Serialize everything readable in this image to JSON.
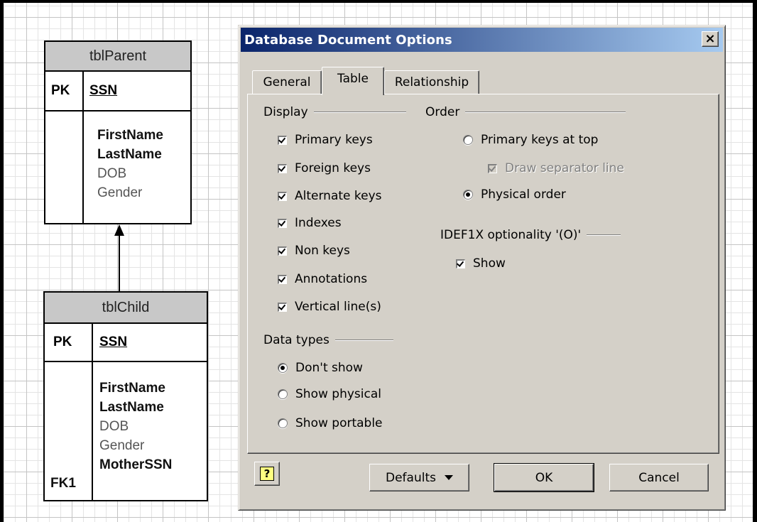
{
  "er_diagram": {
    "parent": {
      "name": "tblParent",
      "pk_label": "PK",
      "pk_field": "SSN",
      "fields": [
        {
          "name": "FirstName",
          "bold": true
        },
        {
          "name": "LastName",
          "bold": true
        },
        {
          "name": "DOB",
          "bold": false
        },
        {
          "name": "Gender",
          "bold": false
        }
      ]
    },
    "child": {
      "name": "tblChild",
      "pk_label": "PK",
      "pk_field": "SSN",
      "fk_label": "FK1",
      "fields": [
        {
          "name": "FirstName",
          "bold": true
        },
        {
          "name": "LastName",
          "bold": true
        },
        {
          "name": "DOB",
          "bold": false
        },
        {
          "name": "Gender",
          "bold": false
        },
        {
          "name": "MotherSSN",
          "bold": true
        }
      ]
    }
  },
  "dialog": {
    "title": "Database Document Options",
    "close_glyph": "×",
    "tabs": [
      {
        "label": "General",
        "active": false
      },
      {
        "label": "Table",
        "active": true
      },
      {
        "label": "Relationship",
        "active": false
      }
    ],
    "display": {
      "label": "Display",
      "options": [
        {
          "label": "Primary keys",
          "checked": true
        },
        {
          "label": "Foreign keys",
          "checked": true
        },
        {
          "label": "Alternate keys",
          "checked": true
        },
        {
          "label": "Indexes",
          "checked": true
        },
        {
          "label": "Non keys",
          "checked": true
        },
        {
          "label": "Annotations",
          "checked": true
        },
        {
          "label": "Vertical line(s)",
          "checked": true
        }
      ]
    },
    "data_types": {
      "label": "Data types",
      "options": [
        {
          "label": "Don't show",
          "selected": true
        },
        {
          "label": "Show physical",
          "selected": false
        },
        {
          "label": "Show portable",
          "selected": false
        }
      ]
    },
    "order": {
      "label": "Order",
      "primary_top": {
        "label": "Primary keys at top",
        "selected": false
      },
      "separator": {
        "label": "Draw separator line",
        "checked": true,
        "disabled": true
      },
      "physical": {
        "label": "Physical order",
        "selected": true
      }
    },
    "idef1x": {
      "label": "IDEF1X optionality '(O)'",
      "show": {
        "label": "Show",
        "checked": true
      }
    },
    "buttons": {
      "help_glyph": "?",
      "defaults": "Defaults",
      "ok": "OK",
      "cancel": "Cancel"
    }
  }
}
